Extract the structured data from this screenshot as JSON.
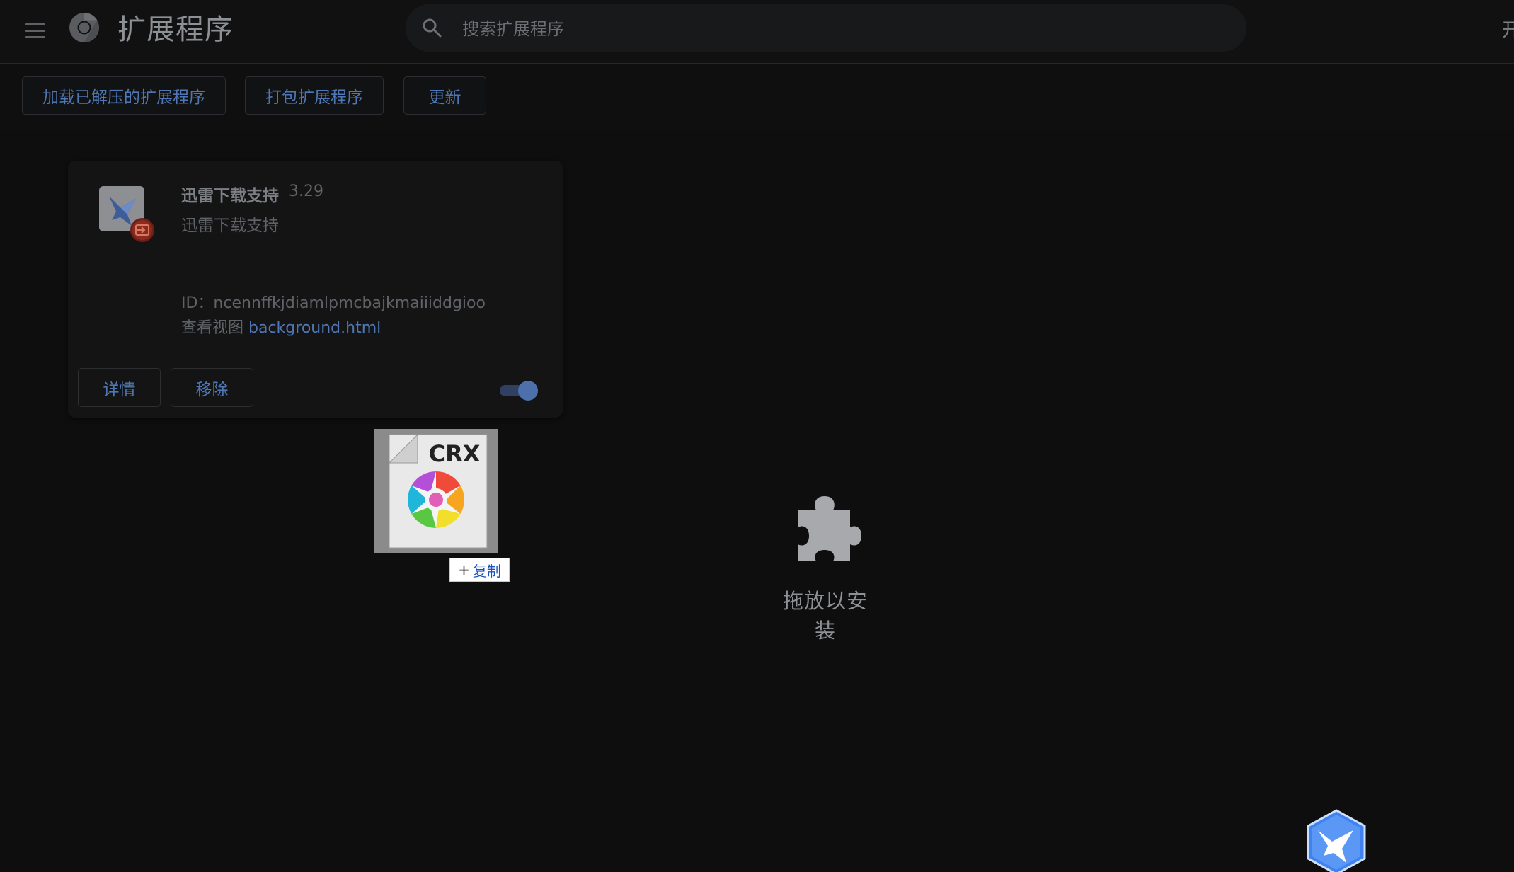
{
  "header": {
    "title": "扩展程序",
    "search_placeholder": "搜索扩展程序",
    "dev_mode_label": "开"
  },
  "toolbar": {
    "load_unpacked": "加载已解压的扩展程序",
    "pack": "打包扩展程序",
    "update": "更新"
  },
  "extension": {
    "name": "迅雷下载支持",
    "version": "3.29",
    "description": "迅雷下载支持",
    "id_line": "ID：ncennffkjdiamlpmcbajkmaiiiddgioo",
    "views_label": "查看视图",
    "views_link": "background.html",
    "details_button": "详情",
    "remove_button": "移除",
    "enabled": true
  },
  "drag": {
    "file_type": "CRX",
    "copy_hint": "复制"
  },
  "dropzone": {
    "label": "拖放以安装"
  },
  "colors": {
    "accent": "#4f77b5",
    "background": "#0e0e0f",
    "card": "#141415"
  },
  "icons": {
    "menu": "hamburger-icon",
    "logo": "chrome-logo-icon",
    "search": "search-icon",
    "extension": "thunder-bird-icon",
    "dropzone": "puzzle-icon",
    "floating": "thunder-bird-badge-icon"
  }
}
